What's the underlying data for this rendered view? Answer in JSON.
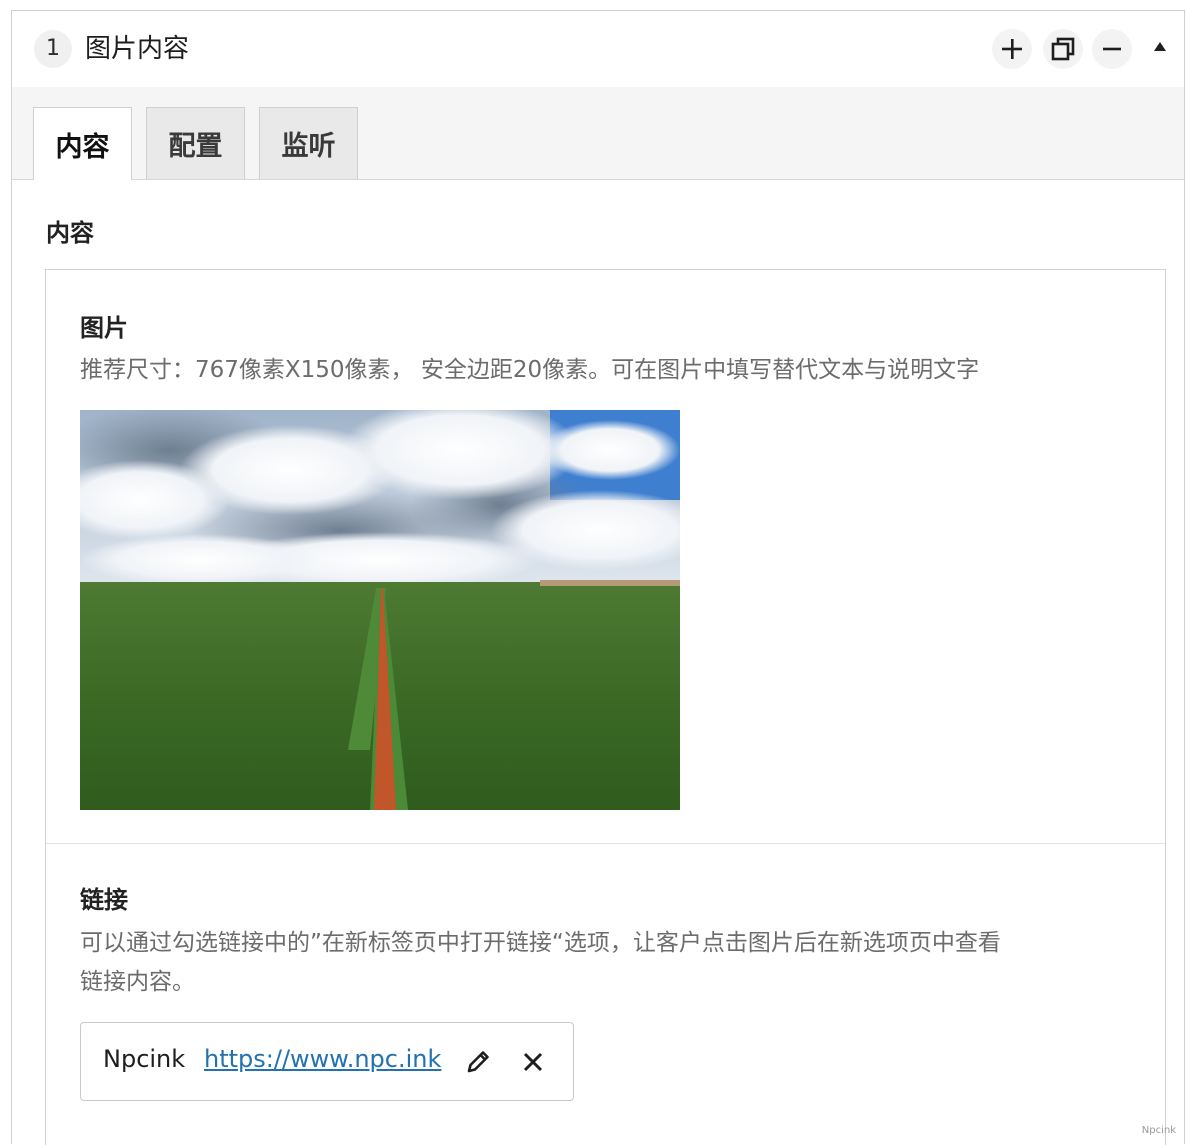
{
  "panel": {
    "index": "1",
    "title": "图片内容",
    "header_actions": [
      {
        "name": "add",
        "icon": "plus-icon"
      },
      {
        "name": "duplicate",
        "icon": "duplicate-icon"
      },
      {
        "name": "remove",
        "icon": "minus-icon"
      },
      {
        "name": "collapse",
        "icon": "caret-up-icon"
      }
    ]
  },
  "tabs": [
    {
      "label": "内容",
      "active": true
    },
    {
      "label": "配置",
      "active": false
    },
    {
      "label": "监听",
      "active": false
    }
  ],
  "content": {
    "section_label": "内容",
    "image_field": {
      "label": "图片",
      "description": "推荐尺寸：767像素X150像素， 安全边距20像素。可在图片中填写替代文本与说明文字"
    },
    "link_field": {
      "label": "链接",
      "description_line1": "可以通过勾选链接中的”在新标签页中打开链接“选项，让客户点击图片后在新选项页中查看",
      "description_line2": "链接内容。",
      "link_name": "Npcink",
      "link_url": "https://www.npc.ink",
      "actions": [
        {
          "name": "edit",
          "icon": "pencil-icon"
        },
        {
          "name": "remove",
          "icon": "close-icon"
        }
      ]
    }
  },
  "watermark": "Npcink",
  "colors": {
    "link": "#2271b1",
    "muted_text": "#6c6c6c",
    "border": "#d0d0d0"
  }
}
